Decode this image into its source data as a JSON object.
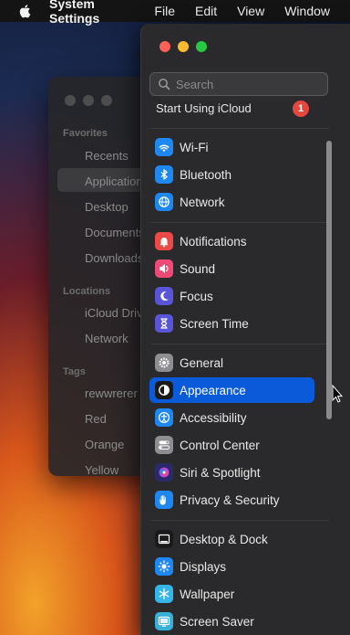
{
  "menubar": {
    "apple_icon": "apple-logo-icon",
    "app_name": "System Settings",
    "menus": [
      "File",
      "Edit",
      "View",
      "Window"
    ]
  },
  "finder": {
    "favorites_label": "Favorites",
    "favorites": [
      "Recents",
      "Applications",
      "Desktop",
      "Documents",
      "Downloads"
    ],
    "locations_label": "Locations",
    "locations": [
      "iCloud Drive",
      "Network"
    ],
    "tags_label": "Tags",
    "tags": [
      "rewwrerer",
      "Red",
      "Orange",
      "Yellow"
    ]
  },
  "settings": {
    "search": {
      "placeholder": "Search",
      "value": ""
    },
    "icloud_label": "Start Using iCloud",
    "icloud_badge": "1",
    "groups": [
      [
        {
          "label": "Wi-Fi",
          "icon": "wifi-icon",
          "color": "#1e88f0"
        },
        {
          "label": "Bluetooth",
          "icon": "bluetooth-icon",
          "color": "#1e88f0"
        },
        {
          "label": "Network",
          "icon": "globe-icon",
          "color": "#1e88f0"
        }
      ],
      [
        {
          "label": "Notifications",
          "icon": "bell-icon",
          "color": "#ec4a46"
        },
        {
          "label": "Sound",
          "icon": "speaker-icon",
          "color": "#ee4a78"
        },
        {
          "label": "Focus",
          "icon": "moon-icon",
          "color": "#5a55d8"
        },
        {
          "label": "Screen Time",
          "icon": "hourglass-icon",
          "color": "#5a55d8"
        }
      ],
      [
        {
          "label": "General",
          "icon": "gear-icon",
          "color": "#8e8e92"
        },
        {
          "label": "Appearance",
          "icon": "appearance-icon",
          "color": "#1a1a1a",
          "selected": true
        },
        {
          "label": "Accessibility",
          "icon": "accessibility-icon",
          "color": "#1e88f0"
        },
        {
          "label": "Control Center",
          "icon": "control-center-icon",
          "color": "#8e8e92"
        },
        {
          "label": "Siri & Spotlight",
          "icon": "siri-icon",
          "color": "#2a2a6a"
        },
        {
          "label": "Privacy & Security",
          "icon": "hand-icon",
          "color": "#1e88f0"
        }
      ],
      [
        {
          "label": "Desktop & Dock",
          "icon": "dock-icon",
          "color": "#1a1a1a"
        },
        {
          "label": "Displays",
          "icon": "sun-icon",
          "color": "#1e88f0"
        },
        {
          "label": "Wallpaper",
          "icon": "snowflake-icon",
          "color": "#36b6e8"
        },
        {
          "label": "Screen Saver",
          "icon": "screensaver-icon",
          "color": "#38b0d8"
        }
      ]
    ]
  }
}
